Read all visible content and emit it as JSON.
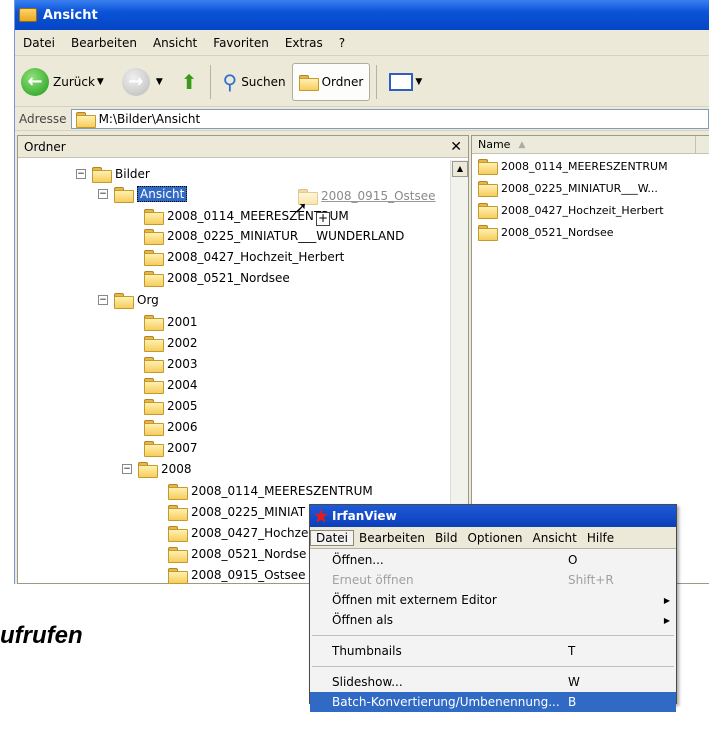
{
  "window": {
    "title": "Ansicht"
  },
  "menubar": [
    "Datei",
    "Bearbeiten",
    "Ansicht",
    "Favoriten",
    "Extras",
    "?"
  ],
  "toolbar": {
    "back": "Zurück",
    "search": "Suchen",
    "folders": "Ordner"
  },
  "address": {
    "label": "Adresse",
    "value": "M:\\Bilder\\Ansicht"
  },
  "left_pane": {
    "title": "Ordner",
    "tree": {
      "bilder": "Bilder",
      "ansicht": "Ansicht",
      "ansicht_children": [
        "2008_0114_MEERESZENTRUM",
        "2008_0225_MINIATUR___WUNDERLAND",
        "2008_0427_Hochzeit_Herbert",
        "2008_0521_Nordsee"
      ],
      "org": "Org",
      "years": [
        "2001",
        "2002",
        "2003",
        "2004",
        "2005",
        "2006",
        "2007"
      ],
      "y2008": "2008",
      "y2008_children": [
        "2008_0114_MEERESZENTRUM",
        "2008_0225_MINIAT",
        "2008_0427_Hochze",
        "2008_0521_Nordse",
        "2008_0915_Ostsee"
      ]
    },
    "drag_ghost": "2008_0915_Ostsee"
  },
  "right_pane": {
    "column": "Name",
    "items": [
      "2008_0114_MEERESZENTRUM",
      "2008_0225_MINIATUR___W...",
      "2008_0427_Hochzeit_Herbert",
      "2008_0521_Nordsee"
    ]
  },
  "irfanview": {
    "title": "IrfanView",
    "menu": [
      "Datei",
      "Bearbeiten",
      "Bild",
      "Optionen",
      "Ansicht",
      "Hilfe"
    ],
    "items": [
      {
        "label": "Öffnen...",
        "key": "O"
      },
      {
        "label": "Erneut öffnen",
        "key": "Shift+R"
      },
      {
        "label": "Öffnen mit externem Editor",
        "key": ""
      },
      {
        "label": "Öffnen als",
        "key": ""
      },
      {
        "label": "Thumbnails",
        "key": "T"
      },
      {
        "label": "Slideshow...",
        "key": "W"
      },
      {
        "label": "Batch-Konvertierung/Umbenennung...",
        "key": "B"
      }
    ]
  },
  "caption": "ufrufen"
}
